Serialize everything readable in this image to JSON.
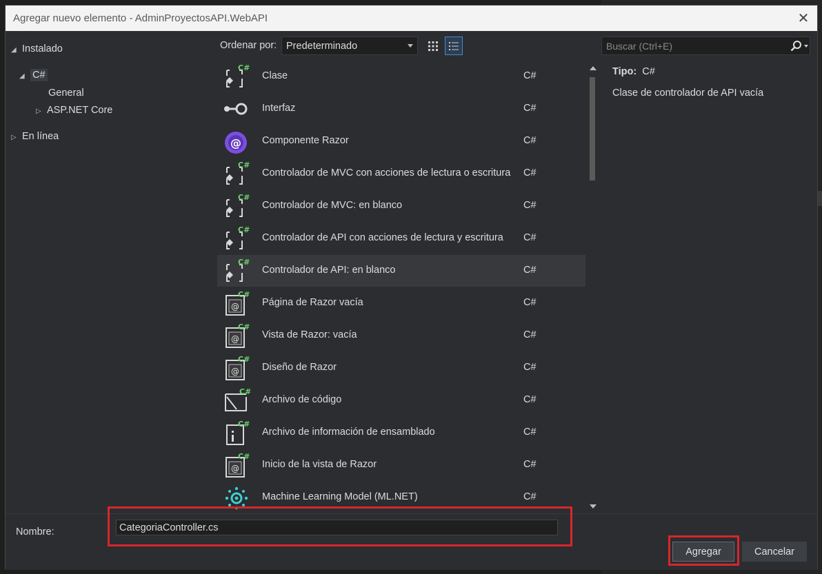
{
  "dialog": {
    "title": "Agregar nuevo elemento - AdminProyectosAPI.WebAPI",
    "close_glyph": "✕"
  },
  "tree": {
    "installed": "Instalado",
    "csharp": "C#",
    "general": "General",
    "aspnet": "ASP.NET Core",
    "online": "En línea"
  },
  "toolbar": {
    "sort_label": "Ordenar por:",
    "sort_value": "Predeterminado",
    "search_placeholder": "Buscar (Ctrl+E)"
  },
  "items": [
    {
      "name": "Clase",
      "lang": "C#",
      "icon": "class-icon"
    },
    {
      "name": "Interfaz",
      "lang": "C#",
      "icon": "interface-icon"
    },
    {
      "name": "Componente Razor",
      "lang": "C#",
      "icon": "razor-component-icon"
    },
    {
      "name": "Controlador de MVC con acciones de lectura o escritura",
      "lang": "C#",
      "icon": "controller-icon"
    },
    {
      "name": "Controlador de MVC: en blanco",
      "lang": "C#",
      "icon": "controller-icon"
    },
    {
      "name": "Controlador de API con acciones de lectura y escritura",
      "lang": "C#",
      "icon": "controller-icon"
    },
    {
      "name": "Controlador de API: en blanco",
      "lang": "C#",
      "icon": "controller-icon",
      "selected": true
    },
    {
      "name": "Página de Razor vacía",
      "lang": "C#",
      "icon": "razor-page-icon"
    },
    {
      "name": "Vista de Razor: vacía",
      "lang": "C#",
      "icon": "razor-page-icon"
    },
    {
      "name": "Diseño de Razor",
      "lang": "C#",
      "icon": "razor-page-icon"
    },
    {
      "name": "Archivo de código",
      "lang": "C#",
      "icon": "code-file-icon"
    },
    {
      "name": "Archivo de información de ensamblado",
      "lang": "C#",
      "icon": "assembly-info-icon"
    },
    {
      "name": "Inicio de la vista de Razor",
      "lang": "C#",
      "icon": "razor-page-icon"
    },
    {
      "name": "Machine Learning Model (ML.NET)",
      "lang": "C#",
      "icon": "ml-model-icon"
    }
  ],
  "details": {
    "type_label": "Tipo:",
    "type_value": "C#",
    "description": "Clase de controlador de API vacía"
  },
  "footer": {
    "name_label": "Nombre:",
    "name_value": "CategoriaController.cs",
    "add_label": "Agregar",
    "cancel_label": "Cancelar"
  },
  "colors": {
    "highlight": "#d9262a",
    "csharp_badge": "#68d36a",
    "razor_purple": "#7b4fe0",
    "ml_cyan": "#3fd0d4"
  }
}
